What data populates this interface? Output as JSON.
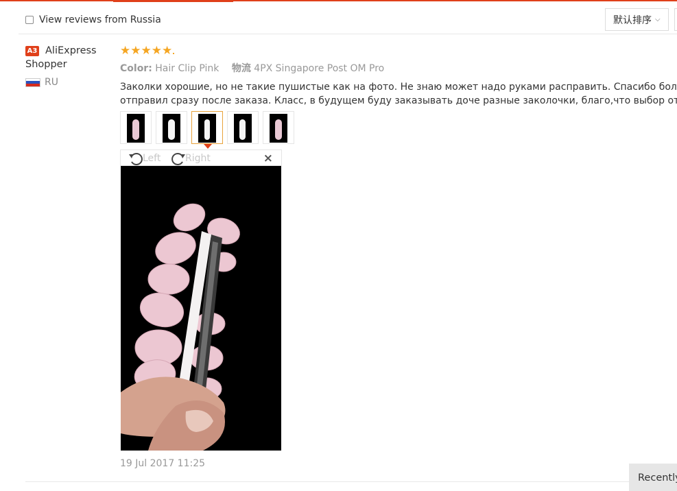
{
  "filter": {
    "checkbox_label": "View reviews from Russia",
    "sort_label": "默认排序"
  },
  "user": {
    "badge": "A3",
    "name_line1": "AliExpress",
    "name_line2": "Shopper",
    "country_code": "RU"
  },
  "review": {
    "rating": 5,
    "color_label": "Color:",
    "color_value": "Hair Clip Pink",
    "shipping_label": "物流",
    "shipping_value": "4PX Singapore Post OM Pro",
    "text_line1": "Заколки хорошие, но не такие пушистые как на фото. Не знаю может надо руками расправить. Спасибо большое пр",
    "text_line2": "отправил сразу после заказа. Класс, в будущем буду заказывать доче разные заколочки, благо,что выбор отличный",
    "date": "19 Jul 2017 11:25"
  },
  "viewer": {
    "rotate_left_label": "Left",
    "rotate_right_label": "Right",
    "close_symbol": "×",
    "thumbnail_count": 5,
    "active_thumbnail": 3
  },
  "floating": {
    "recently_label": "Recently"
  },
  "colors": {
    "accent": "#e0401a",
    "star": "#f5a623",
    "active_thumb_border": "#e8a23a",
    "muted_text": "#999999"
  }
}
